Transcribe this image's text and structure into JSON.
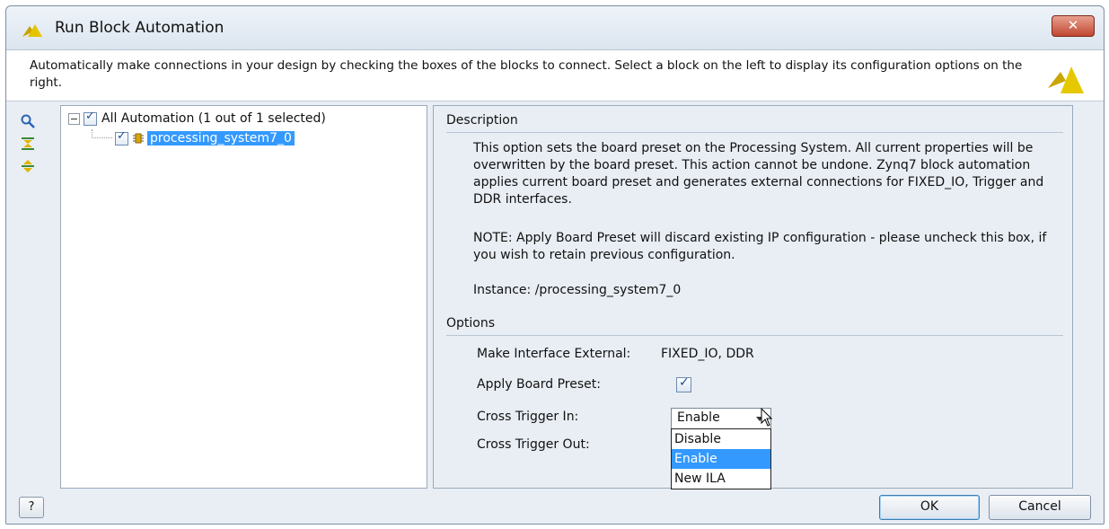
{
  "window": {
    "title": "Run Block Automation",
    "close_label": "✕"
  },
  "banner": {
    "text": "Automatically make connections in your design by checking the boxes of the blocks to connect. Select a block on the left to display its configuration options on the right."
  },
  "toolbar": {
    "icons": [
      "search-icon",
      "collapse-all-icon",
      "expand-all-icon"
    ]
  },
  "tree": {
    "root_label": "All Automation (1 out of 1 selected)",
    "root_checked": true,
    "child_label": "processing_system7_0",
    "child_checked": true
  },
  "description": {
    "header": "Description",
    "paragraph1": "This option sets the board preset on the Processing System. All current properties will be overwritten by the board preset. This action cannot be undone. Zynq7 block automation applies current board preset and generates external connections for FIXED_IO, Trigger and DDR interfaces.",
    "paragraph2": "NOTE: Apply Board Preset will discard existing IP configuration - please uncheck this box, if you wish to retain previous configuration.",
    "instance": "Instance: /processing_system7_0"
  },
  "options": {
    "header": "Options",
    "make_interface_label": "Make Interface External:",
    "make_interface_value": "FIXED_IO, DDR",
    "apply_preset_label": "Apply Board Preset:",
    "apply_preset_checked": true,
    "cross_trigger_in_label": "Cross Trigger In:",
    "cross_trigger_in_value": "Enable",
    "cross_trigger_out_label": "Cross Trigger Out:",
    "dropdown_options": [
      "Disable",
      "Enable",
      "New ILA"
    ],
    "dropdown_highlighted": "Enable"
  },
  "footer": {
    "help_label": "?",
    "ok_label": "OK",
    "cancel_label": "Cancel"
  },
  "colors": {
    "selection": "#3399ff",
    "window_bg": "#e9eef5",
    "close_button": "#c14732"
  }
}
